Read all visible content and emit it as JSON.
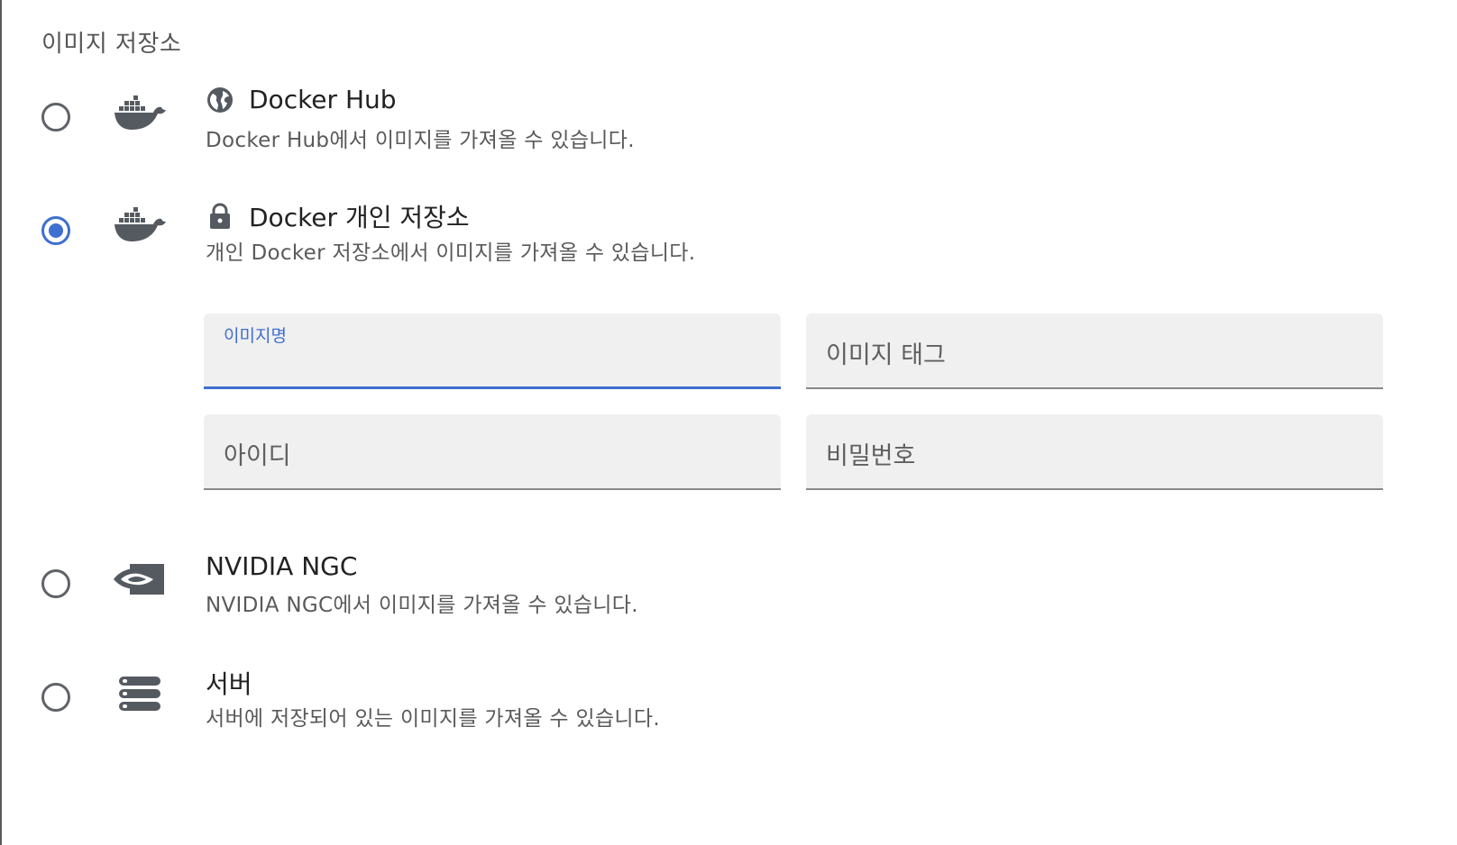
{
  "section": {
    "title": "이미지 저장소"
  },
  "options": [
    {
      "title": "Docker Hub",
      "description": "Docker Hub에서 이미지를 가져올 수 있습니다.",
      "icon": "docker-icon",
      "title_icon": "globe-icon",
      "selected": false
    },
    {
      "title": "Docker 개인 저장소",
      "description": "개인 Docker 저장소에서 이미지를 가져올 수 있습니다.",
      "icon": "docker-icon",
      "title_icon": "lock-icon",
      "selected": true
    },
    {
      "title": "NVIDIA NGC",
      "description": "NVIDIA NGC에서 이미지를 가져올 수 있습니다.",
      "icon": "nvidia-icon",
      "selected": false
    },
    {
      "title": "서버",
      "description": "서버에 저장되어 있는 이미지를 가져올 수 있습니다.",
      "icon": "server-icon",
      "selected": false
    }
  ],
  "form": {
    "image_name": {
      "label": "이미지명",
      "value": ""
    },
    "image_tag": {
      "placeholder": "이미지 태그",
      "value": ""
    },
    "username": {
      "placeholder": "아이디",
      "value": ""
    },
    "password": {
      "placeholder": "비밀번호",
      "value": ""
    }
  },
  "colors": {
    "accent": "#3f6fd0",
    "icon": "#555a60",
    "field_bg": "#f0f0f0"
  }
}
